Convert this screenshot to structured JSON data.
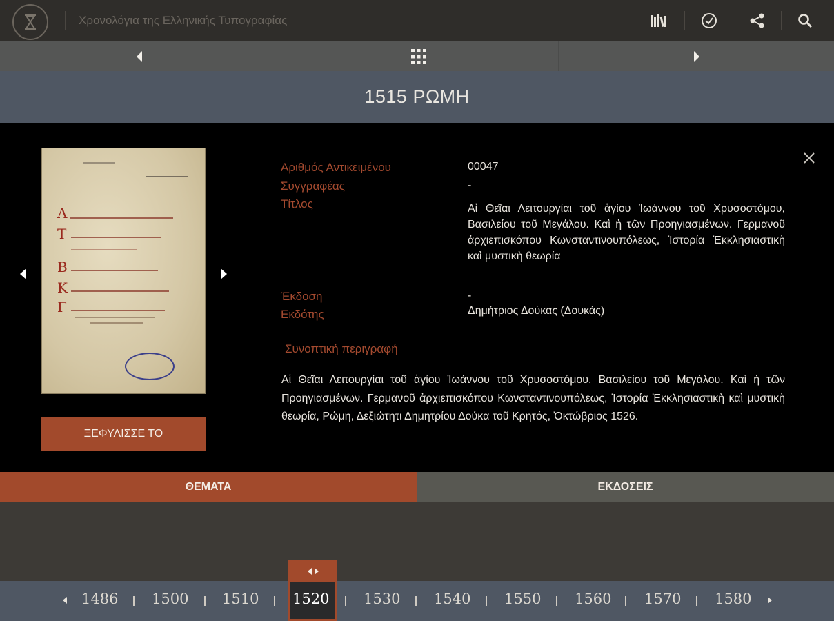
{
  "header": {
    "app_title": "Χρονολόγια της Ελληνικής Τυπογραφίας",
    "icons": [
      "library-icon",
      "check-circle-icon",
      "share-icon",
      "search-icon"
    ]
  },
  "nav": {
    "prev": "previous-icon",
    "grid": "grid-icon",
    "next": "next-icon"
  },
  "year_title": "1515 ΡΩΜΗ",
  "item": {
    "fields": [
      {
        "label": "Αριθμός Αντικειμένου",
        "value": "00047"
      },
      {
        "label": "Συγγραφέας",
        "value": "-"
      },
      {
        "label": "Τίτλος",
        "value": "Αἱ Θεῖαι Λειτουργίαι τοῦ ἁγίου Ἰωάννου τοῦ Χρυσοστόμου, Βασιλείου τοῦ Μεγάλου. Καὶ ἡ τῶν Προηγιασμένων. Γερμανοῦ ἀρχιεπισκόπου Κωνσταντινουπόλεως, Ἱστορία Ἐκκλησιαστικὴ καὶ μυστικὴ θεωρία"
      },
      {
        "label": "Έκδοση",
        "value": "-"
      },
      {
        "label": "Εκδότης",
        "value": "Δημήτριος Δούκας (Δουκάς)"
      }
    ],
    "synopsis_heading": "Συνοπτική περιγραφή",
    "synopsis": "Αἱ Θεῖαι Λειτουργίαι τοῦ ἁγίου Ἰωάννου τοῦ Χρυσοστόμου, Βασιλείου τοῦ Μεγάλου. Καὶ ἡ τῶν Προηγιασμένων. Γερμανοῦ ἀρχιεπισκόπου Κωνσταντινουπόλεως, Ἱστορία Ἐκκλησιαστικὴ καὶ μυστικὴ θεωρία, Ρώμη, Δεξιώτητι Δημητρίου Δούκα τοῦ Κρητός, Ὀκτώβριος 1526.",
    "flip_button": "ΞΕΦΥΛΙΣΣΕ ΤΟ"
  },
  "tabs": {
    "topics": "ΘΕΜΑΤΑ",
    "editions": "ΕΚΔΟΣΕΙΣ"
  },
  "timeline": {
    "years": [
      "1486",
      "1500",
      "1510",
      "1520",
      "1530",
      "1540",
      "1550",
      "1560",
      "1570",
      "1580"
    ],
    "active_year": "1520"
  },
  "colors": {
    "accent": "#a24a2c",
    "label": "#a44a2f",
    "header_bg": "#2f2d2a",
    "year_bar": "#4f5763"
  }
}
